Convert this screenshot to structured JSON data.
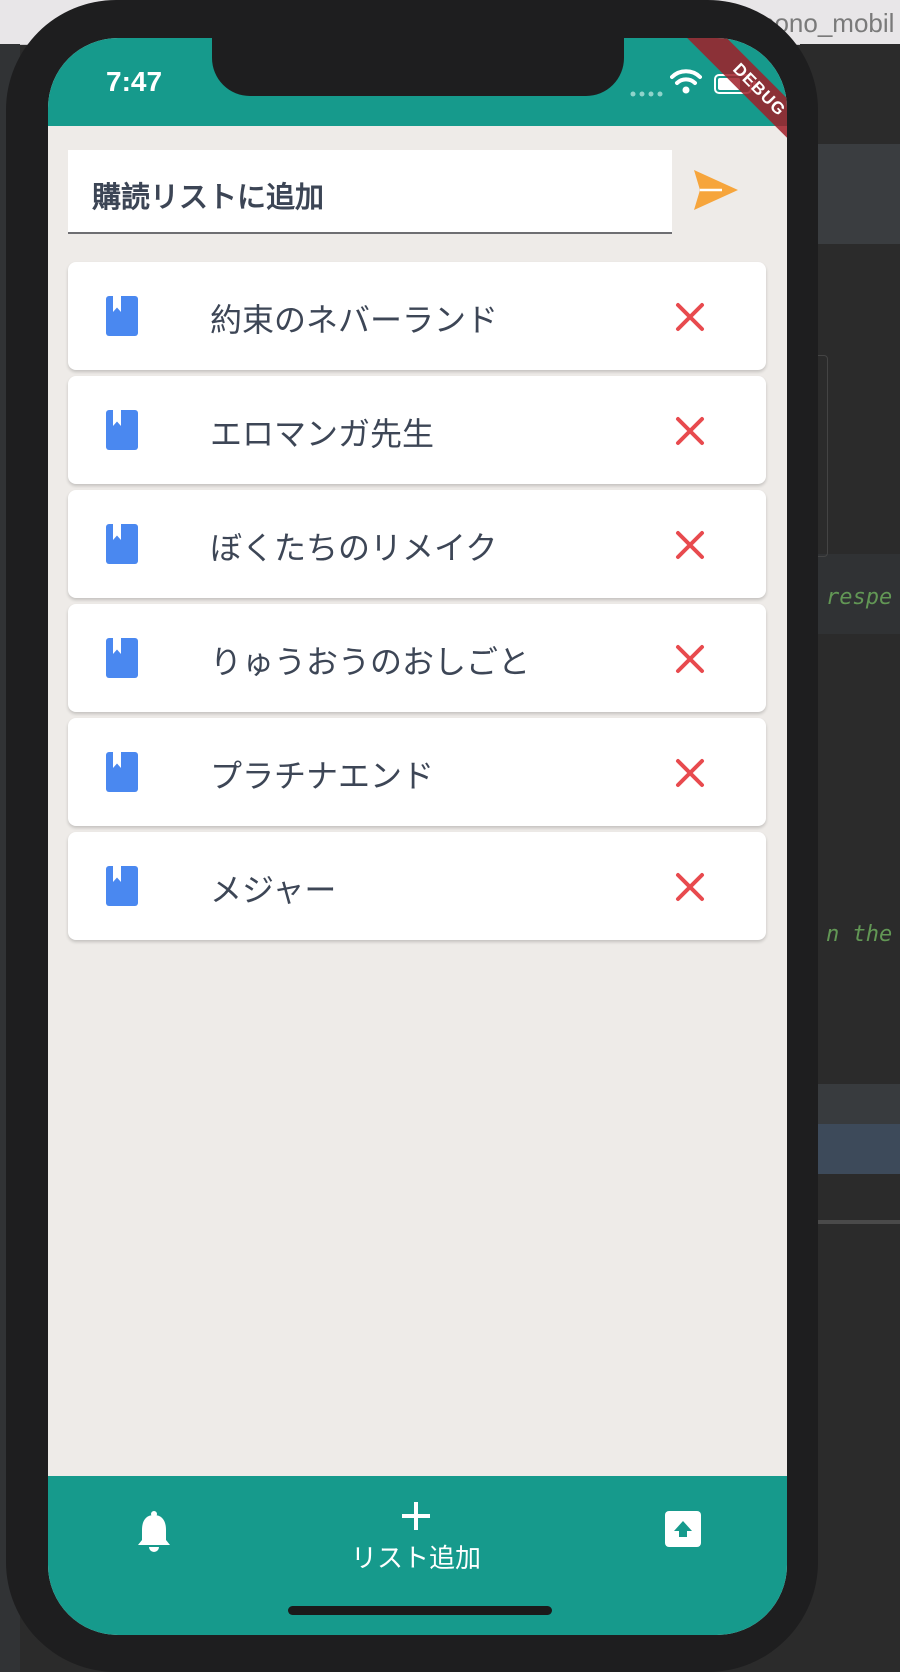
{
  "ide": {
    "window_title": "pono_mobil",
    "code_line_1": "respe",
    "code_line_2": "n the s"
  },
  "status_bar": {
    "time": "7:47",
    "debug_banner": "DEBUG"
  },
  "input": {
    "placeholder": "購読リストに追加"
  },
  "list": {
    "items": [
      {
        "title": "約束のネバーランド"
      },
      {
        "title": "エロマンガ先生"
      },
      {
        "title": "ぼくたちのリメイク"
      },
      {
        "title": "りゅうおうのおしごと"
      },
      {
        "title": "プラチナエンド"
      },
      {
        "title": "メジャー"
      }
    ]
  },
  "bottom_nav": {
    "add_label": "リスト追加"
  },
  "icons": {
    "book": "book-icon",
    "delete": "close-icon",
    "send": "send-icon",
    "bell": "bell-icon",
    "add": "plus-icon",
    "archive": "archive-upload-icon"
  },
  "colors": {
    "primary": "#169a8c",
    "background": "#eeebe8",
    "book_icon": "#4a88f0",
    "delete_icon": "#e84a4e",
    "send_icon": "#f6a53c",
    "text": "#3d4656"
  }
}
